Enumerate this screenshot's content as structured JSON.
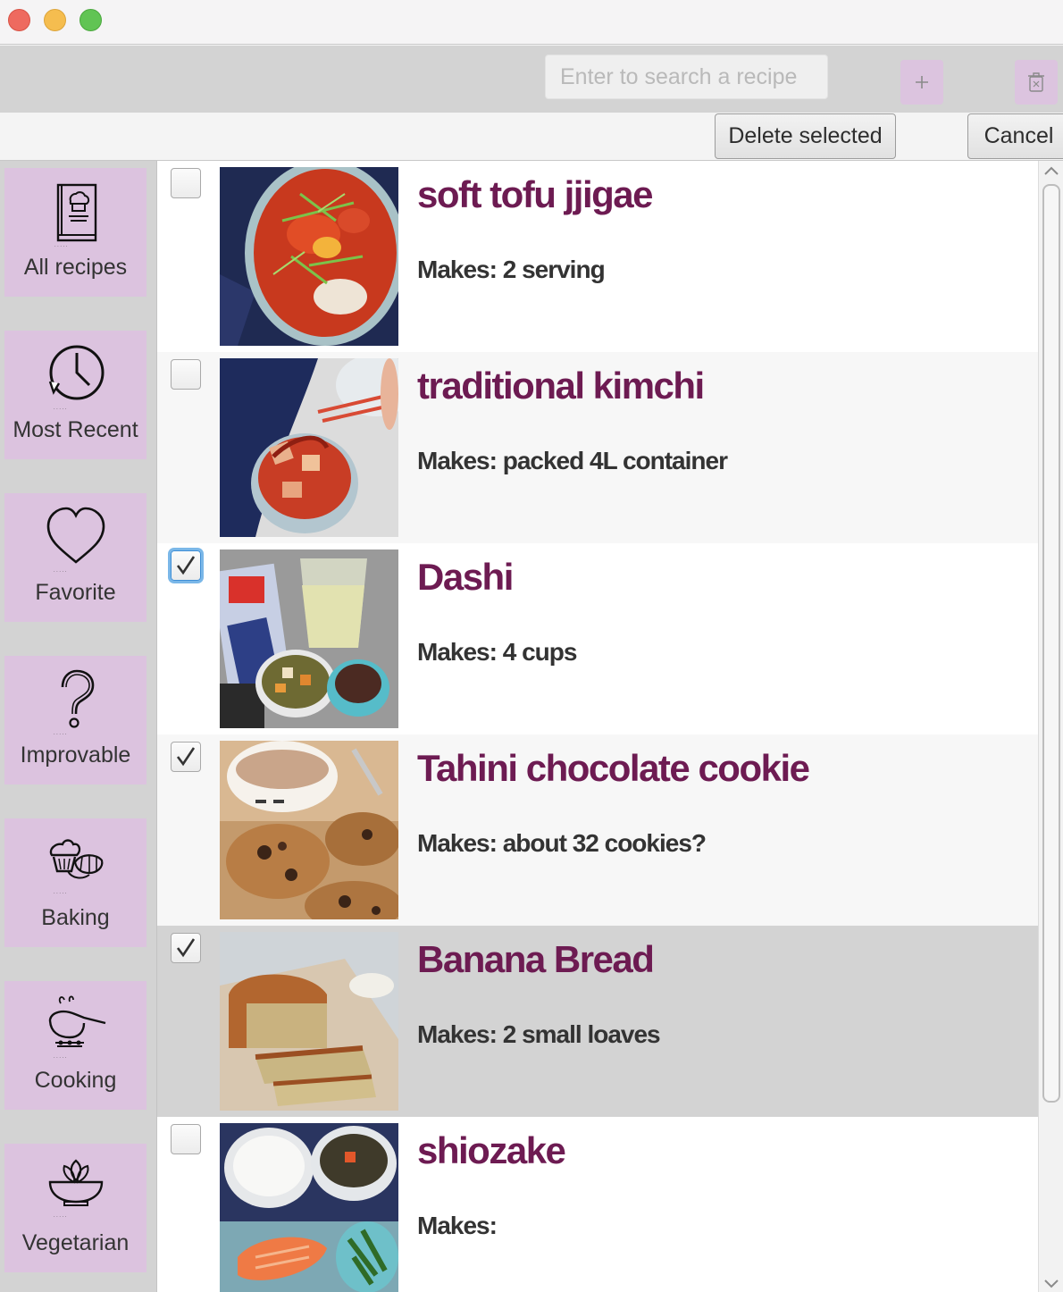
{
  "toolbar": {
    "search_placeholder": "Enter to search a recipe",
    "add_icon": "plus-icon",
    "trash_icon": "trash-icon"
  },
  "actions": {
    "delete_label": "Delete selected",
    "cancel_label": "Cancel"
  },
  "sidebar": {
    "items": [
      {
        "label": "All recipes",
        "icon": "recipe-book-icon"
      },
      {
        "label": "Most Recent",
        "icon": "clock-icon"
      },
      {
        "label": "Favorite",
        "icon": "heart-icon"
      },
      {
        "label": "Improvable",
        "icon": "question-icon"
      },
      {
        "label": "Baking",
        "icon": "cupcake-icon"
      },
      {
        "label": "Cooking",
        "icon": "pot-icon"
      },
      {
        "label": "Vegetarian",
        "icon": "leaf-bowl-icon"
      }
    ]
  },
  "recipes": [
    {
      "name": "soft tofu jjigae",
      "makes": "Makes: 2 serving",
      "checked": false
    },
    {
      "name": "traditional kimchi",
      "makes": "Makes: packed 4L container",
      "checked": false
    },
    {
      "name": "Dashi",
      "makes": "Makes: 4 cups",
      "checked": true
    },
    {
      "name": "Tahini chocolate cookie",
      "makes": "Makes: about 32 cookies?",
      "checked": true
    },
    {
      "name": "Banana Bread",
      "makes": "Makes: 2 small loaves",
      "checked": true
    },
    {
      "name": "shiozake",
      "makes": "Makes:",
      "checked": false
    }
  ],
  "colors": {
    "accent": "#dcc3df",
    "title": "#6d1b52",
    "toolbar": "#d3d3d3"
  }
}
